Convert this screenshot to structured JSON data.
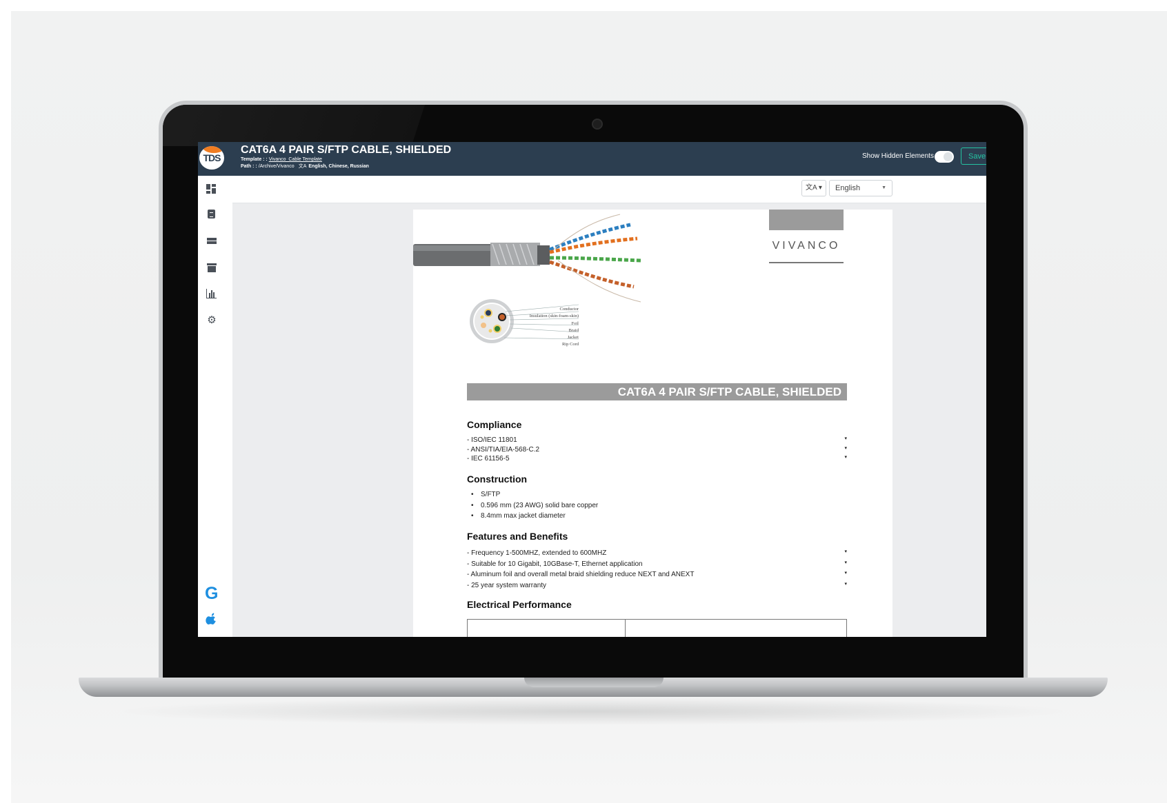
{
  "app": {
    "logo_text": "TDS",
    "doc_title": "CAT6A 4 PAIR S/FTP CABLE, SHIELDED",
    "template_label": "Template : :",
    "template_link": "Vivanco_Cable Template",
    "path_label": "Path : :",
    "path_value": "/Archive/Vivanco",
    "languages": "English, Chinese, Russian",
    "show_hidden_label": "Show Hidden Elements",
    "save_label": "Save"
  },
  "sidebar": {
    "items": [
      {
        "name": "dashboard",
        "icon": "dashboard-icon"
      },
      {
        "name": "documents",
        "icon": "clipboard-icon"
      },
      {
        "name": "tables",
        "icon": "table-icon"
      },
      {
        "name": "archive",
        "icon": "archive-icon"
      },
      {
        "name": "reports",
        "icon": "bar-chart-icon"
      },
      {
        "name": "settings",
        "icon": "gear-icon"
      }
    ],
    "bottom": [
      "google-icon",
      "apple-icon"
    ]
  },
  "toolbar": {
    "translate_label": "文A ▾",
    "language_selected": "English"
  },
  "document": {
    "brand": "VIVANCO",
    "cross_section_labels": [
      "Conductor",
      "Insulation (skin-foam-skin)",
      "Foil",
      "Braid",
      "Jacket",
      "Rip Cord"
    ],
    "banner_title": "CAT6A 4 PAIR S/FTP CABLE, SHIELDED",
    "compliance": {
      "heading": "Compliance",
      "items": [
        "- ISO/IEC 11801",
        "- ANSI/TIA/EIA-568-C.2",
        "- IEC 61156-5"
      ]
    },
    "construction": {
      "heading": "Construction",
      "items": [
        "S/FTP",
        "0.596 mm (23 AWG) solid bare copper",
        "8.4mm max jacket diameter"
      ]
    },
    "features": {
      "heading": "Features and Benefits",
      "items": [
        "- Frequency 1-500MHZ, extended to 600MHZ",
        "- Suitable for 10 Gigabit, 10GBase-T, Ethernet application",
        "- Aluminum foil and overall metal braid shielding reduce NEXT and ANEXT",
        "- 25 year system warranty"
      ]
    },
    "electrical": {
      "heading": "Electrical Performance"
    }
  },
  "colors": {
    "topbar": "#2c3e50",
    "accent": "#25c4a2",
    "logo_orange": "#f07d22",
    "banner_gray": "#9b9b9b",
    "sidebar_bottom_icons": "#1e8fe0"
  }
}
